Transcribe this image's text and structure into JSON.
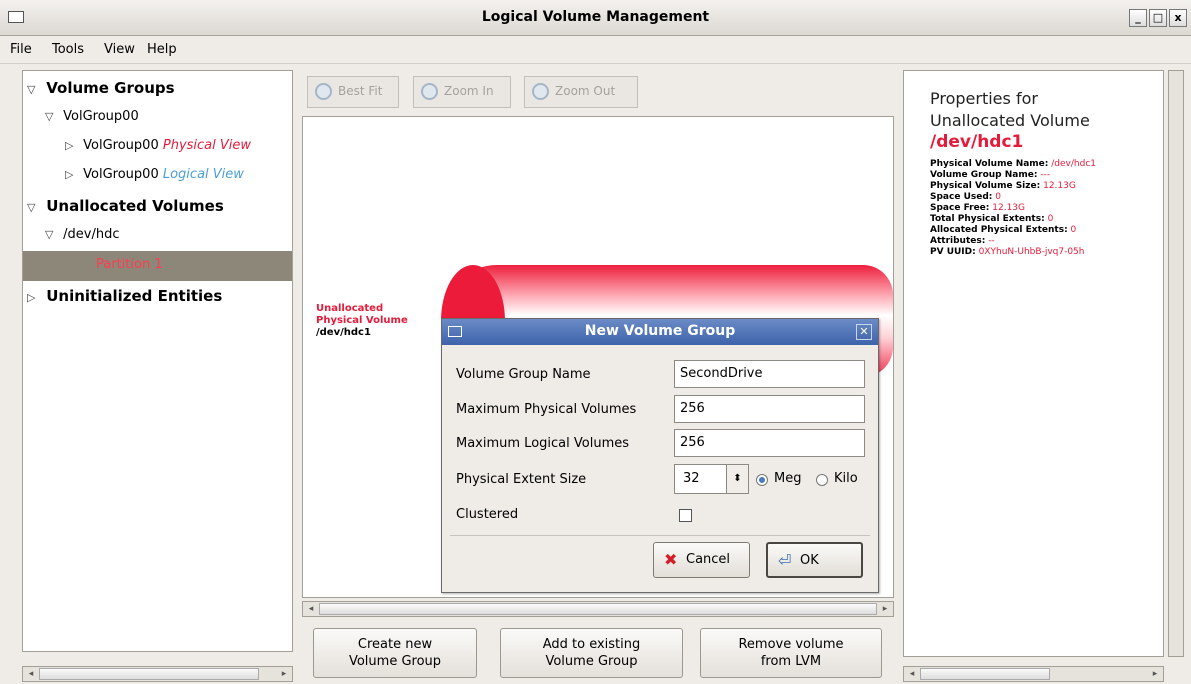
{
  "window": {
    "title": "Logical Volume Management",
    "buttons": [
      "_",
      "□",
      "x"
    ]
  },
  "menu": [
    "File",
    "Tools",
    "View",
    "Help"
  ],
  "tree": {
    "volume_groups": "Volume Groups",
    "volgroup": "VolGroup00",
    "physical_prefix": "VolGroup00",
    "physical_view": "Physical View",
    "logical_prefix": "VolGroup00",
    "logical_view": "Logical View",
    "unallocated": "Unallocated Volumes",
    "dev": "/dev/hdc",
    "partition": "Partition 1",
    "uninitialized": "Uninitialized Entities"
  },
  "toolbar": {
    "best_fit": "Best Fit",
    "zoom_in": "Zoom In",
    "zoom_out": "Zoom Out"
  },
  "canvas": {
    "label1": "Unallocated",
    "label2": "Physical Volume",
    "label3": "/dev/hdc1"
  },
  "actions": {
    "create": [
      "Create new",
      "Volume Group"
    ],
    "add": [
      "Add to existing",
      "Volume Group"
    ],
    "remove": [
      "Remove volume",
      "from LVM"
    ]
  },
  "properties": {
    "heading1": "Properties for",
    "heading2": "Unallocated Volume",
    "heading3": "/dev/hdc1",
    "rows": [
      {
        "k": "Physical Volume Name:",
        "v": "/dev/hdc1"
      },
      {
        "k": "Volume Group Name:",
        "v": "---"
      },
      {
        "k": "Physical Volume Size:",
        "v": "12.13G"
      },
      {
        "k": "Space Used:",
        "v": "0"
      },
      {
        "k": "Space Free:",
        "v": "12.13G"
      },
      {
        "k": "Total Physical Extents:",
        "v": "0"
      },
      {
        "k": "Allocated Physical Extents:",
        "v": "0"
      },
      {
        "k": "Attributes:",
        "v": "--"
      },
      {
        "k": "PV UUID:",
        "v": "0XYhuN-UhbB-jvq7-05h"
      }
    ]
  },
  "dialog": {
    "title": "New Volume Group",
    "vg_name_label": "Volume Group Name",
    "vg_name_value": "SecondDrive",
    "max_pv_label": "Maximum Physical Volumes",
    "max_pv_value": "256",
    "max_lv_label": "Maximum Logical Volumes",
    "max_lv_value": "256",
    "extent_label": "Physical Extent Size",
    "extent_value": "32",
    "unit_meg": "Meg",
    "unit_kilo": "Kilo",
    "unit_selected": "Meg",
    "clustered_label": "Clustered",
    "clustered_checked": false,
    "cancel": "Cancel",
    "ok": "OK"
  },
  "colors": {
    "accent_red": "#e41b3a",
    "accent_blue": "#4a9fd8",
    "dialog_title": "#3d63aa"
  }
}
